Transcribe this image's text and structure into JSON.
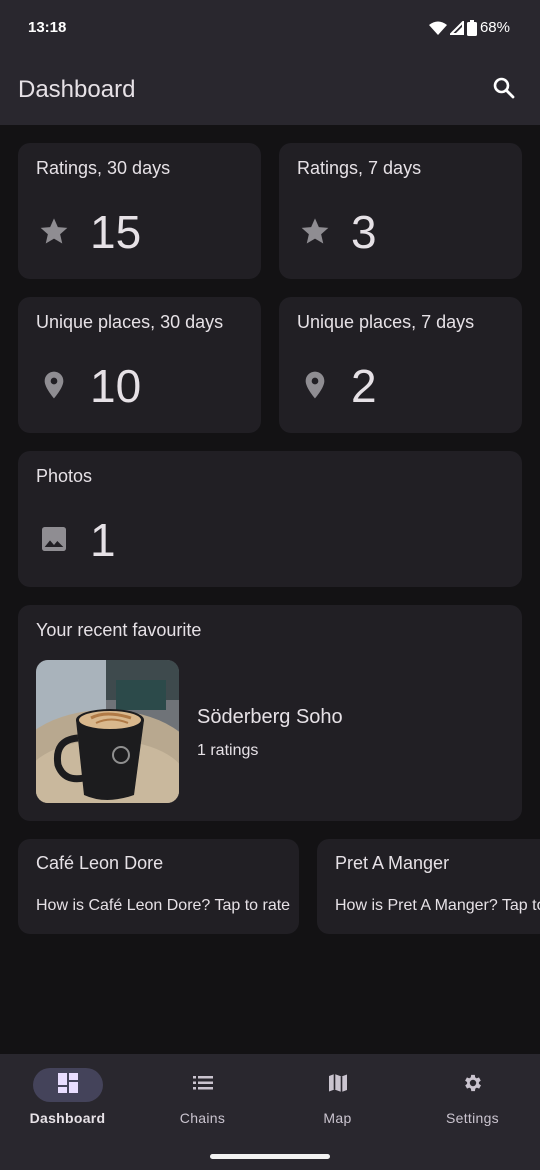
{
  "status_bar": {
    "time": "13:18",
    "battery": "68%",
    "icons": [
      "wifi-icon",
      "signal-icon",
      "battery-icon"
    ]
  },
  "app_bar": {
    "title": "Dashboard",
    "search_icon": "search-icon"
  },
  "stats": [
    {
      "label": "Ratings, 30 days",
      "value": "15",
      "icon": "star-icon"
    },
    {
      "label": "Ratings, 7 days",
      "value": "3",
      "icon": "star-icon"
    },
    {
      "label": "Unique places, 30 days",
      "value": "10",
      "icon": "location-pin-icon"
    },
    {
      "label": "Unique places, 7 days",
      "value": "2",
      "icon": "location-pin-icon"
    },
    {
      "label": "Photos",
      "value": "1",
      "icon": "image-icon"
    }
  ],
  "recent_favourite": {
    "heading": "Your recent favourite",
    "name": "Söderberg Soho",
    "ratings": "1 ratings",
    "image": "coffee-mug-photo"
  },
  "rate_prompts": [
    {
      "name": "Café Leon Dore",
      "prompt": "How is Café Leon Dore? Tap to rate"
    },
    {
      "name": "Pret A Manger",
      "prompt": "How is Pret A Manger? Tap to rate"
    }
  ],
  "bottom_nav": {
    "items": [
      {
        "label": "Dashboard",
        "icon": "dashboard-icon",
        "active": true
      },
      {
        "label": "Chains",
        "icon": "list-icon",
        "active": false
      },
      {
        "label": "Map",
        "icon": "map-icon",
        "active": false
      },
      {
        "label": "Settings",
        "icon": "gear-icon",
        "active": false
      }
    ]
  },
  "colors": {
    "background": "#131214",
    "surface": "#211f24",
    "bar": "#29272e",
    "active_pill": "#44435a",
    "icon_gray": "#8f8d92"
  }
}
